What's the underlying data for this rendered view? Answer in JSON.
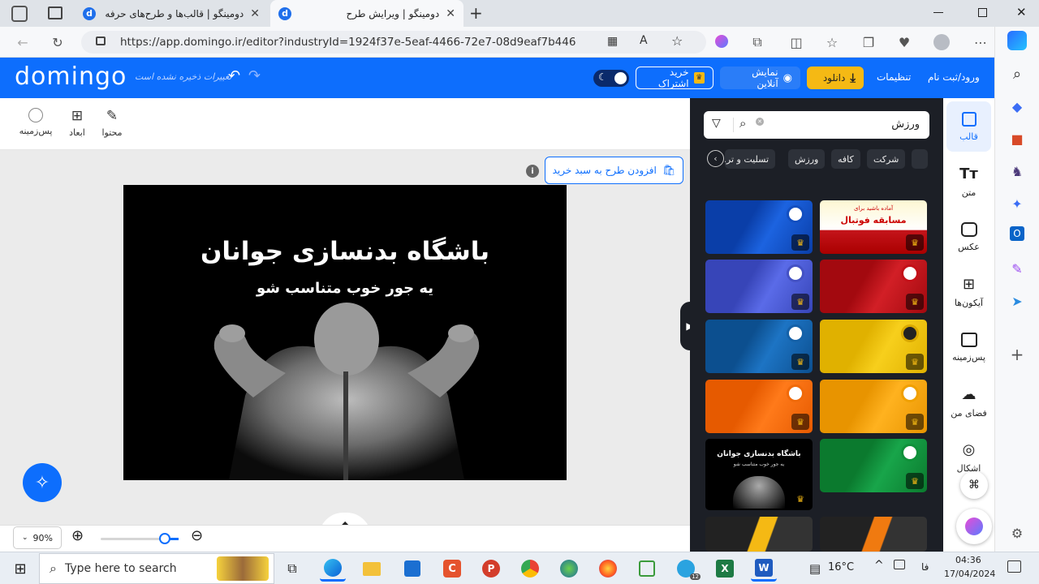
{
  "browser": {
    "tabs": [
      {
        "title": "دومینگو | قالب‌ها و طرح‌های حرفه"
      },
      {
        "title": "دومینگو | ویرایش طرح"
      }
    ],
    "url": "https://app.domingo.ir/editor?industryId=1924f37e-5eaf-4466-72e7-08d9eaf7b446",
    "new_tab_symbol": "+"
  },
  "header": {
    "logo": "domingo",
    "save_status": "تغییرات ذخیره نشده است",
    "buy_subscription": "خرید اشتراک",
    "online_preview": "نمایش آنلاین",
    "download": "دانلود",
    "settings": "تنظیمات",
    "login": "ورود/ثبت نام"
  },
  "toolbar": {
    "content": "محتوا",
    "dimensions": "ابعاد",
    "background": "پس‌زمینه"
  },
  "canvas": {
    "add_to_cart": "افزودن طرح به سبد خرید",
    "title": "باشگاه بدنسازی جوانان",
    "subtitle": "یه جور خوب متناسب شو",
    "zoom": "90%"
  },
  "panel": {
    "search_value": "ورزش",
    "chips": [
      "شرکت",
      "کافه",
      "ورزش",
      "تسلیت و تر..."
    ],
    "thumb_football_title": "آماده باشید برای",
    "thumb_football_big": "مسابقه فوتبال",
    "thumb_gym_title": "باشگاه بدنسازی جوانان",
    "thumb_gym_sub": "یه جور خوب متناسب شو"
  },
  "sidebar": {
    "items": [
      "قالب",
      "متن",
      "عکس",
      "آیکون‌ها",
      "پس‌زمینه",
      "فضای من",
      "اشکال"
    ]
  },
  "taskbar": {
    "search_placeholder": "Type here to search",
    "temperature": "16°C",
    "language": "فا",
    "time": "04:36",
    "date": "17/04/2024",
    "badge": "12"
  },
  "colors": {
    "brand_blue": "#0d6efd",
    "download_yellow": "#f5b914",
    "panel_dark": "#1c1f26"
  }
}
